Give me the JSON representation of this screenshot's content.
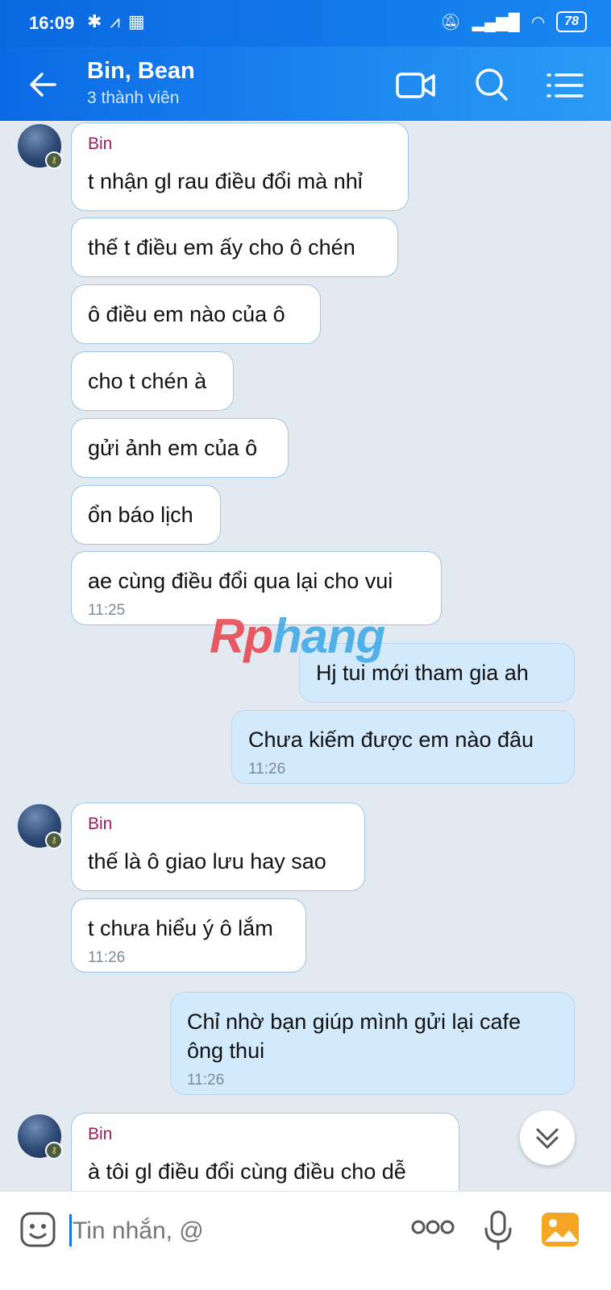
{
  "status_bar": {
    "time": "16:09",
    "battery": "78"
  },
  "header": {
    "title": "Bin, Bean",
    "subtitle": "3 thành viên"
  },
  "messages": [
    {
      "sender": "Bin",
      "text": "t nhận gl rau điều đổi mà nhỉ"
    },
    {
      "text": "thế t điều em ấy cho ô chén"
    },
    {
      "text": "ô điều em nào của ô"
    },
    {
      "text": "cho t chén à"
    },
    {
      "text": "gửi ảnh em của ô"
    },
    {
      "text": "ổn báo lịch"
    },
    {
      "text": "ae cùng điều đổi qua lại cho vui",
      "time": "11:25"
    },
    {
      "text": "Hj tui mới tham gia ah"
    },
    {
      "text": "Chưa kiếm được em nào đâu",
      "time": "11:26"
    },
    {
      "sender": "Bin",
      "text": "thế là ô giao lưu hay sao"
    },
    {
      "text": "t chưa hiểu ý ô lắm",
      "time": "11:26"
    },
    {
      "text_line1": "Chỉ nhờ bạn giúp mình gửi lại cafe",
      "text_line2": "ông thui",
      "time": "11:26"
    },
    {
      "sender": "Bin",
      "text": "à tôi gl điều đổi cùng điều cho dễ"
    }
  ],
  "watermark": {
    "part1": "Rp",
    "part2": "hang"
  },
  "composer": {
    "placeholder": "Tin nhắn, @"
  }
}
